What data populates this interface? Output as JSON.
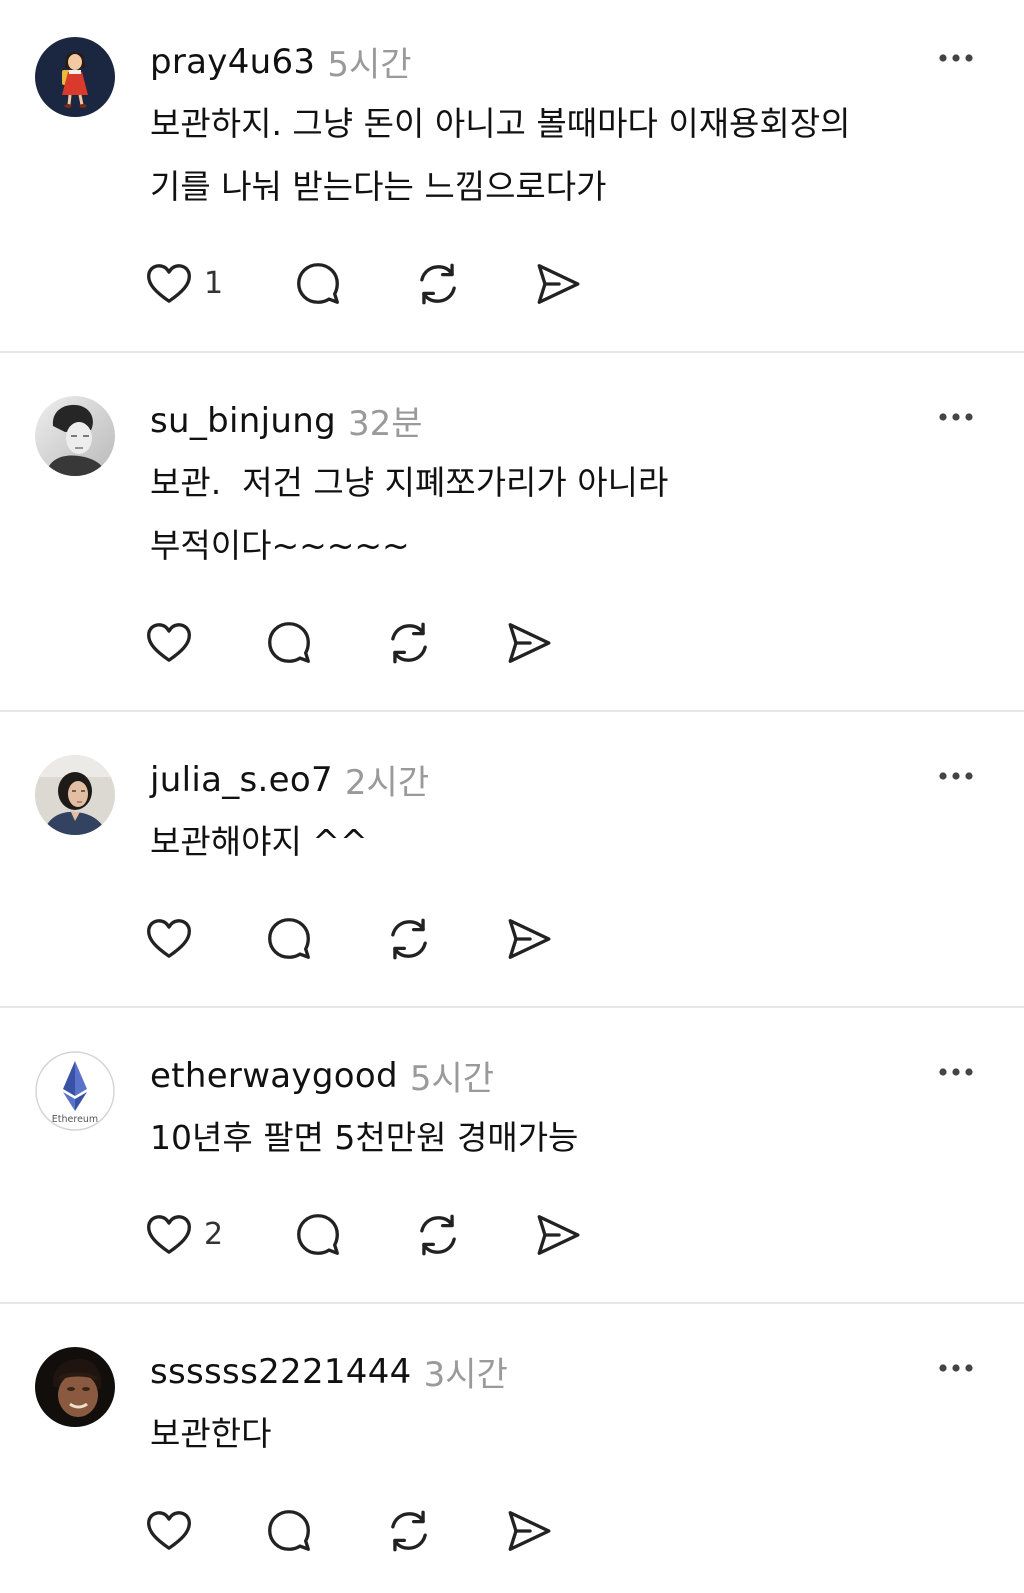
{
  "posts": [
    {
      "username": "pray4u63",
      "time": "5시간",
      "body_lines": [
        "보관하지. 그냥 돈이 아니고 볼때마다 이재용회장의",
        "기를 나눠 받는다는 느낌으로다가"
      ],
      "like_count": "1",
      "avatar": "illustrated-girl-avatar"
    },
    {
      "username": "su_binjung",
      "time": "32분",
      "body_lines": [
        "보관.  저건 그냥 지폐쪼가리가 아니라",
        "부적이다~~~~~"
      ],
      "avatar": "grayscale-portrait-avatar"
    },
    {
      "username": "julia_s.eo7",
      "time": "2시간",
      "body_lines": [
        "보관해야지 ^^"
      ],
      "avatar": "portrait-avatar"
    },
    {
      "username": "etherwaygood",
      "time": "5시간",
      "body_lines": [
        "10년후 팔면 5천만원 경매가능"
      ],
      "like_count": "2",
      "avatar": "ethereum-logo-avatar",
      "avatar_label": "Ethereum"
    },
    {
      "username": "ssssss2221444",
      "time": "3시간",
      "body_lines": [
        "보관한다"
      ],
      "avatar": "dark-portrait-avatar"
    }
  ],
  "icons": {
    "more": "more-icon",
    "like": "heart-icon",
    "comment": "comment-icon",
    "repost": "repost-icon",
    "share": "share-icon"
  },
  "colors": {
    "background": "#ffffff",
    "text": "#111111",
    "muted": "#9a9a9a",
    "divider": "#e8e8e8",
    "icon": "#222222"
  }
}
